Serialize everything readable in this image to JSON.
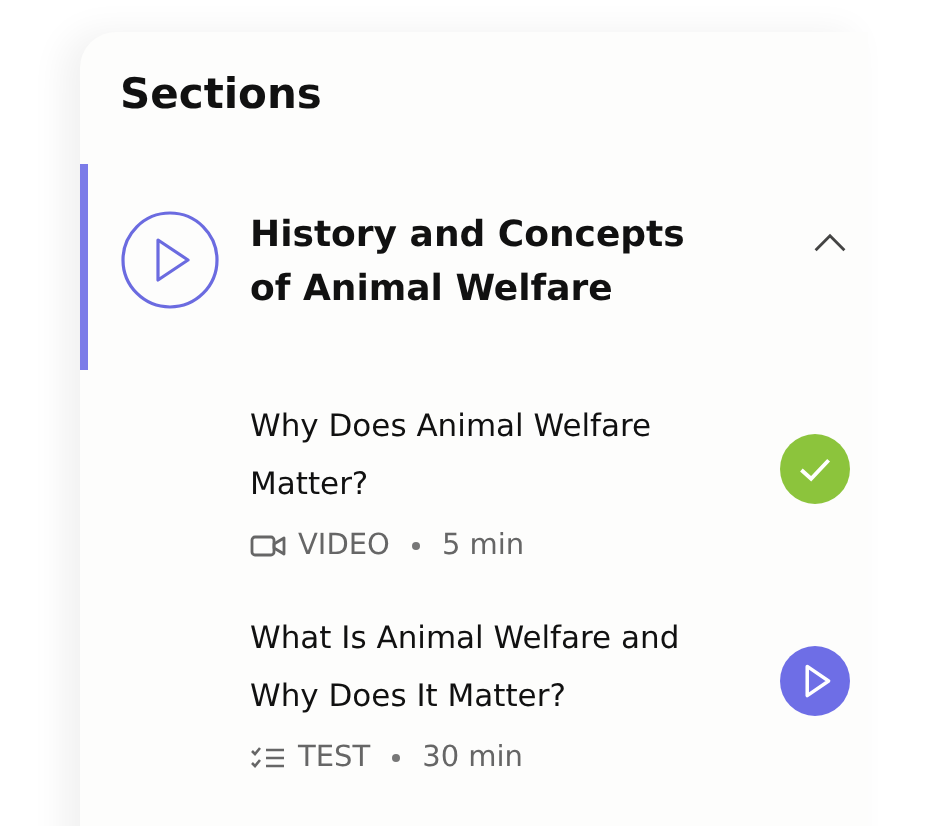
{
  "heading": "Sections",
  "section": {
    "title": "History and Concepts of Animal Welfare",
    "expanded": true,
    "selected": true
  },
  "items": [
    {
      "title": "Why Does Animal Welfare Matter?",
      "kind": "video",
      "type_label": "VIDEO",
      "duration": "5 min",
      "completed": true
    },
    {
      "title": "What Is Animal Welfare and Why Does It Matter?",
      "kind": "test",
      "type_label": "TEST",
      "duration": "30 min",
      "completed": false
    }
  ]
}
